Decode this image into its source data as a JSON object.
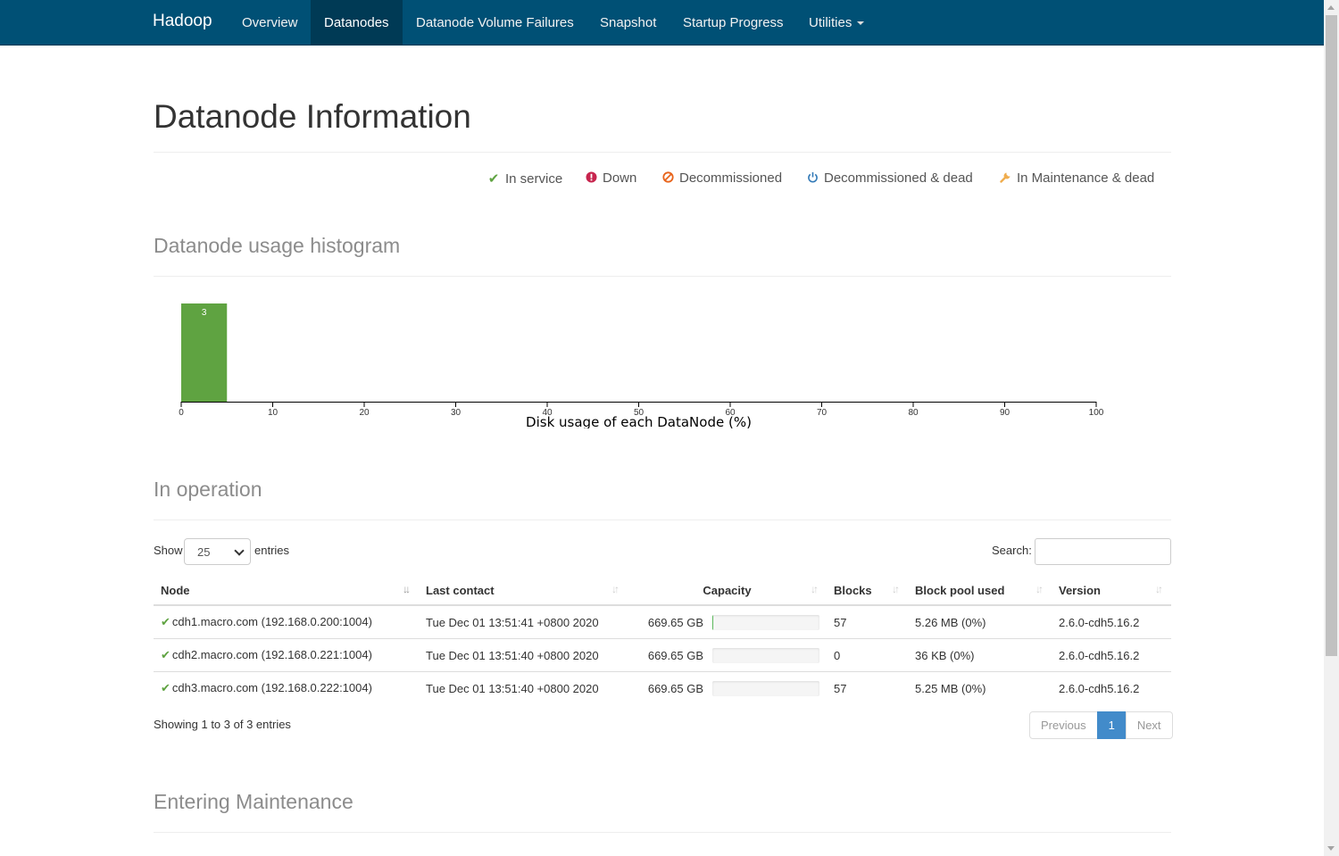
{
  "navbar": {
    "brand": "Hadoop",
    "items": [
      {
        "label": "Overview"
      },
      {
        "label": "Datanodes"
      },
      {
        "label": "Datanode Volume Failures"
      },
      {
        "label": "Snapshot"
      },
      {
        "label": "Startup Progress"
      },
      {
        "label": "Utilities"
      }
    ],
    "active": "Datanodes",
    "color": "#005075"
  },
  "page": {
    "title": "Datanode Information"
  },
  "legend": [
    {
      "icon": "check-icon",
      "label": "In service",
      "color": "#5fa341"
    },
    {
      "icon": "exclamation-circle-icon",
      "label": "Down",
      "color": "#c7254e"
    },
    {
      "icon": "ban-icon",
      "label": "Decommissioned",
      "color": "#d9534f"
    },
    {
      "icon": "power-icon",
      "label": "Decommissioned & dead",
      "color": "#337ab7"
    },
    {
      "icon": "wrench-icon",
      "label": "In Maintenance & dead",
      "color": "#f0ad4e"
    }
  ],
  "histogram": {
    "title": "Datanode usage histogram",
    "chart_data": {
      "type": "bar",
      "bins": [
        {
          "from": 0,
          "to": 5,
          "count": 3
        }
      ],
      "xlabel": "Disk usage of each DataNode (%)",
      "xlim": [
        0,
        100
      ],
      "ticks": [
        0,
        10,
        20,
        30,
        40,
        50,
        60,
        70,
        80,
        90,
        100
      ],
      "bar_color": "#5fa341"
    }
  },
  "in_operation": {
    "title": "In operation",
    "show_label": "Show",
    "entries_label": "entries",
    "page_size": "25",
    "search_label": "Search:",
    "columns": [
      "Node",
      "Last contact",
      "Capacity",
      "Blocks",
      "Block pool used",
      "Version"
    ],
    "rows": [
      {
        "node": "cdh1.macro.com (192.168.0.200:1004)",
        "last_contact": "Tue Dec 01 13:51:41 +0800 2020",
        "capacity": "669.65 GB",
        "usage": 0.01,
        "blocks": "57",
        "block_pool_used": "5.26 MB (0%)",
        "version": "2.6.0-cdh5.16.2"
      },
      {
        "node": "cdh2.macro.com (192.168.0.221:1004)",
        "last_contact": "Tue Dec 01 13:51:40 +0800 2020",
        "capacity": "669.65 GB",
        "usage": 0.0,
        "blocks": "0",
        "block_pool_used": "36 KB (0%)",
        "version": "2.6.0-cdh5.16.2"
      },
      {
        "node": "cdh3.macro.com (192.168.0.222:1004)",
        "last_contact": "Tue Dec 01 13:51:40 +0800 2020",
        "capacity": "669.65 GB",
        "usage": 0.0,
        "blocks": "57",
        "block_pool_used": "5.25 MB (0%)",
        "version": "2.6.0-cdh5.16.2"
      }
    ],
    "info": "Showing 1 to 3 of 3 entries",
    "pager": {
      "previous": "Previous",
      "page": "1",
      "next": "Next"
    }
  },
  "entering_maintenance": {
    "title": "Entering Maintenance"
  }
}
